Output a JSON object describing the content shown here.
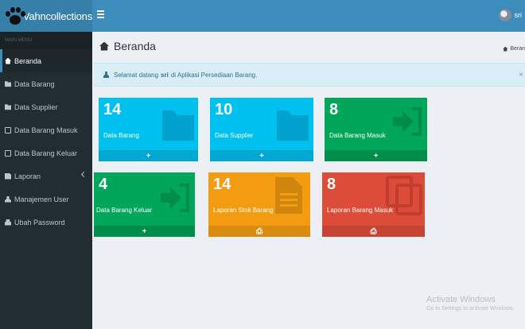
{
  "header": {
    "app_title": "Vahncollections",
    "user_name": "sri"
  },
  "sidebar": {
    "menu_header": "MAIN MENU",
    "items": [
      {
        "label": "Beranda",
        "icon": "home-icon",
        "active": true
      },
      {
        "label": "Data Barang",
        "icon": "folder-icon"
      },
      {
        "label": "Data Supplier",
        "icon": "folder-icon"
      },
      {
        "label": "Data Barang Masuk",
        "icon": "file-icon"
      },
      {
        "label": "Data Barang Keluar",
        "icon": "file-icon"
      },
      {
        "label": "Laporan",
        "icon": "document-icon",
        "has_submenu": true
      },
      {
        "label": "Manajemen User",
        "icon": "user-icon"
      },
      {
        "label": "Ubah Password",
        "icon": "lock-icon"
      }
    ]
  },
  "content": {
    "page_title": "Beranda",
    "breadcrumb": "Beran",
    "alert": {
      "prefix": "Selamat datang",
      "user": "sri",
      "suffix": "di Aplikasi Persediaan Barang."
    },
    "boxes": [
      {
        "count": "14",
        "label": "Data Barang",
        "footer_icon": "+",
        "color": "#00c0ef"
      },
      {
        "count": "10",
        "label": "Data Supplier",
        "footer_icon": "+",
        "color": "#00c0ef"
      },
      {
        "count": "8",
        "label": "Data Barang Masuk",
        "footer_icon": "+",
        "color": "#00a65a"
      },
      {
        "count": "4",
        "label": "Data Barang Keluar",
        "footer_icon": "+",
        "color": "#00a65a"
      },
      {
        "count": "14",
        "label": "Laporan Stok Barang",
        "footer_icon": "print",
        "color": "#f39c12"
      },
      {
        "count": "8",
        "label": "Laporan Barang Masuk",
        "footer_icon": "print",
        "color": "#dd4b39"
      }
    ]
  },
  "watermark": {
    "line1": "Activate Windows",
    "line2": "Go to Settings to activate Windows."
  }
}
